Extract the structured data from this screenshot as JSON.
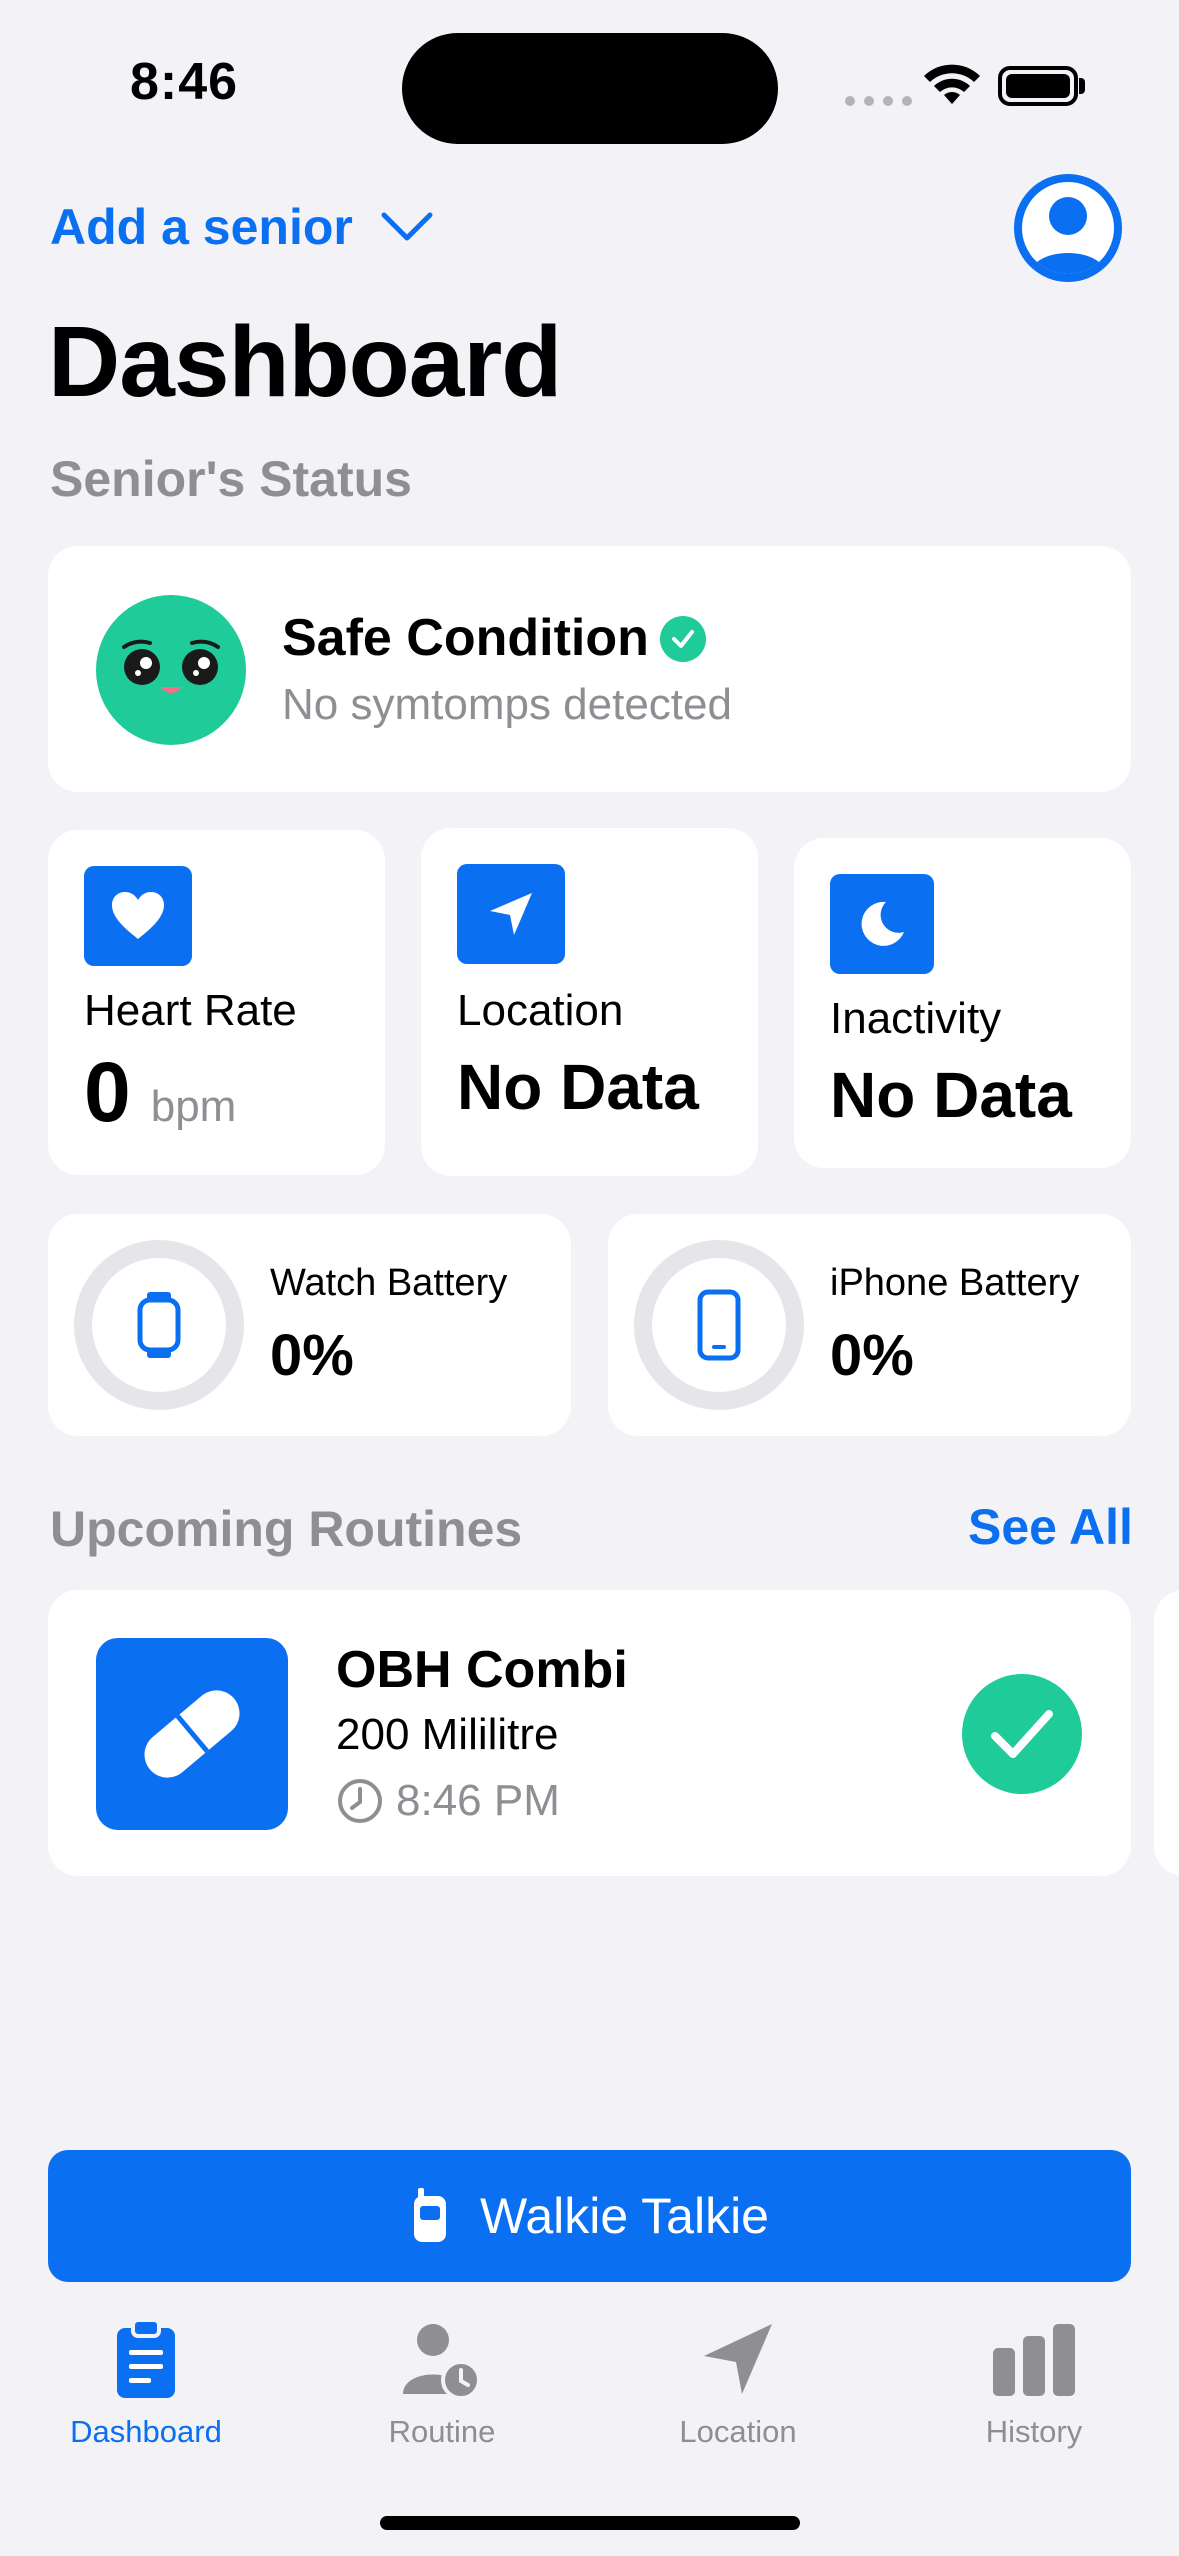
{
  "status_bar": {
    "time": "8:46"
  },
  "header": {
    "add_senior": "Add a senior",
    "title": "Dashboard",
    "status_section": "Senior's Status"
  },
  "condition": {
    "title": "Safe Condition",
    "subtitle": "No symtomps detected"
  },
  "stats": {
    "heart": {
      "label": "Heart Rate",
      "value": "0",
      "unit": "bpm"
    },
    "location": {
      "label": "Location",
      "value": "No Data"
    },
    "inactivity": {
      "label": "Inactivity",
      "value": "No Data"
    }
  },
  "batteries": {
    "watch": {
      "label": "Watch Battery",
      "value": "0%",
      "level": 0
    },
    "iphone": {
      "label": "iPhone Battery",
      "value": "0%",
      "level": 0
    }
  },
  "routines": {
    "section": "Upcoming Routines",
    "see_all": "See All",
    "items": [
      {
        "name": "OBH Combi",
        "dose": "200 Mililitre",
        "time": "8:46 PM",
        "done": true
      }
    ]
  },
  "walkie": {
    "label": "Walkie Talkie"
  },
  "tabs": [
    {
      "label": "Dashboard",
      "icon": "clipboard-icon",
      "active": true
    },
    {
      "label": "Routine",
      "icon": "person-clock-icon",
      "active": false
    },
    {
      "label": "Location",
      "icon": "location-arrow-icon",
      "active": false
    },
    {
      "label": "History",
      "icon": "bar-chart-icon",
      "active": false
    }
  ],
  "colors": {
    "accent": "#0A6FF0",
    "success": "#1FCB98",
    "background": "#F2F2F7",
    "secondary_text": "#8E8E93"
  }
}
